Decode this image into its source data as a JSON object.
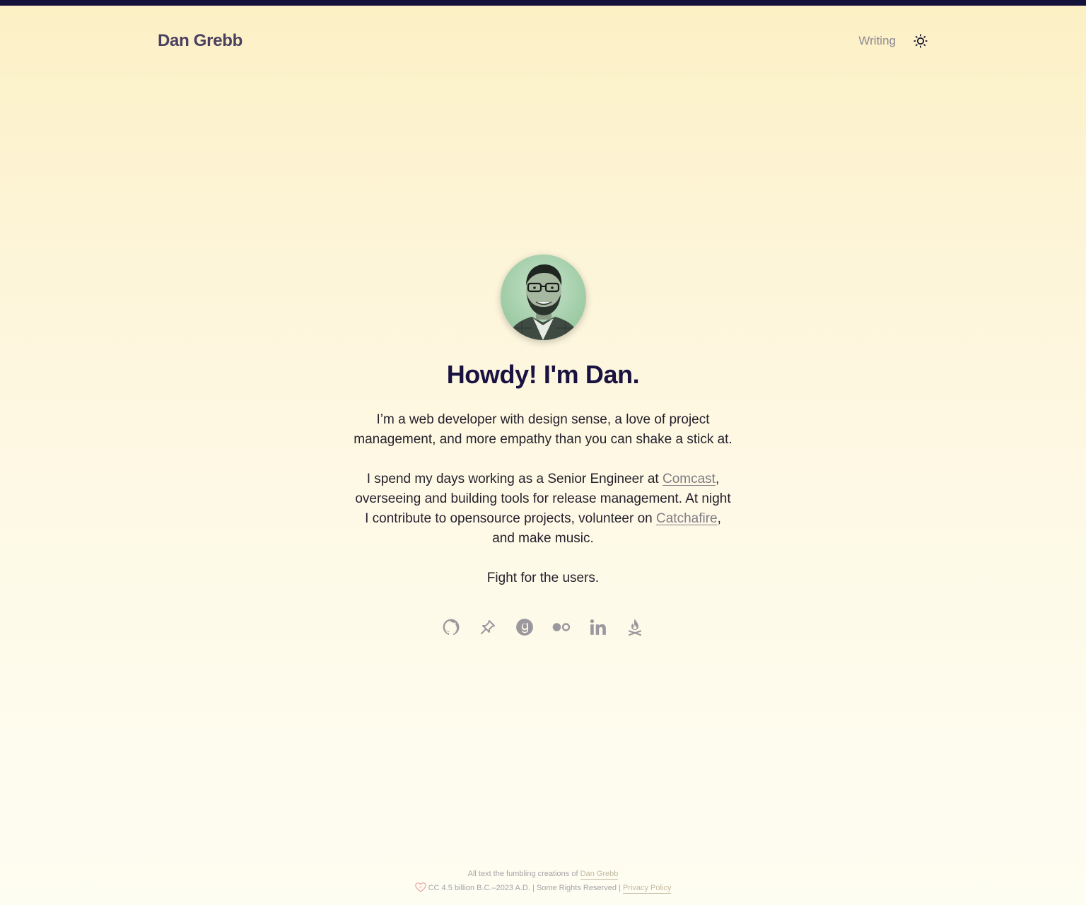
{
  "header": {
    "brand": "Dan Grebb",
    "nav": [
      {
        "label": "Writing"
      }
    ],
    "theme_toggle_icon": "sun-icon"
  },
  "hero": {
    "avatar_alt": "Portrait of Dan Grebb",
    "heading": "Howdy! I'm Dan.",
    "intro": "I’m a web developer with design sense, a love of project management, and more empathy than you can shake a stick at.",
    "work": {
      "before_comcast": "I spend my days working as a Senior Engineer at ",
      "comcast_link": "Comcast",
      "middle": ", overseeing and building tools for release management. At night I contribute to opensource projects, volunteer on ",
      "catchafire_link": "Catchafire",
      "after": ", and make music."
    },
    "tagline": "Fight for the users."
  },
  "socials": [
    {
      "icon": "github-icon"
    },
    {
      "icon": "pinboard-icon"
    },
    {
      "icon": "goodreads-icon"
    },
    {
      "icon": "flickr-icon"
    },
    {
      "icon": "linkedin-icon"
    },
    {
      "icon": "campfire-icon"
    }
  ],
  "footer": {
    "line1_text": "All text the fumbling creations of ",
    "line1_link": "Dan Grebb",
    "license_text": "CC 4.5 billion B.C.–2023 A.D. | Some Rights Reserved | ",
    "privacy_link": "Privacy Policy"
  },
  "colors": {
    "topbar": "#14113a",
    "heading": "#1a1240",
    "brand": "#4a4060",
    "icon": "#9a989e"
  }
}
